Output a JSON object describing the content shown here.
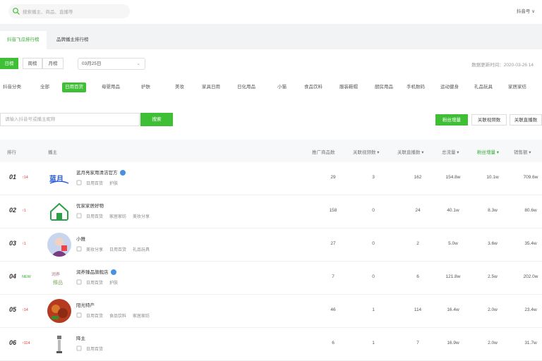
{
  "search": {
    "placeholder": "搜索播主、商品、直播等"
  },
  "user": {
    "label": "抖音号 ∨"
  },
  "tabs": [
    {
      "label": "抖音飞瓜排行榜"
    },
    {
      "label": "品牌播主排行榜"
    }
  ],
  "period": {
    "day": "日榜",
    "week": "周榜",
    "month": "月榜",
    "date": "03月25日"
  },
  "update_text": "数据更新时间：2020-03-26 14",
  "categories": [
    "抖音分类",
    "全部",
    "日用百货",
    "母婴用品",
    "护肤",
    "美妆",
    "家具日用",
    "日化用品",
    "小猫",
    "食品饮料",
    "服装鞋帽",
    "厨房用品",
    "手机数码",
    "运动健身",
    "礼品玩具",
    "家居家纺"
  ],
  "keyword": {
    "placeholder": "请输入抖音号或播主昵称",
    "button": "搜索"
  },
  "sort": [
    "粉丝增量",
    "关联视频数",
    "关联直播数"
  ],
  "columns": [
    "排行",
    "播主",
    "推广商品数",
    "关联视频数",
    "关联直播数",
    "总流量",
    "粉丝增量",
    "销售额"
  ],
  "rows": [
    {
      "rank": "01",
      "change": "↑14",
      "dir": "up",
      "name": "蓝月亮家用清洁官方",
      "verified": true,
      "tags": [
        "日用百货",
        "护肤"
      ],
      "goods": "29",
      "videos": "3",
      "lives": "162",
      "traffic": "154.8w",
      "fans": "10.1w",
      "sales": "709.6w"
    },
    {
      "rank": "02",
      "change": "↑1",
      "dir": "up",
      "name": "优家家居好物",
      "verified": false,
      "tags": [
        "日用百货",
        "家居家纺",
        "美妆分享"
      ],
      "goods": "158",
      "videos": "0",
      "lives": "24",
      "traffic": "40.1w",
      "fans": "8.3w",
      "sales": "80.6w"
    },
    {
      "rank": "03",
      "change": "↑1",
      "dir": "up",
      "name": "小雅",
      "verified": false,
      "tags": [
        "美妆分享",
        "日用百货",
        "礼品玩具"
      ],
      "goods": "27",
      "videos": "0",
      "lives": "2",
      "traffic": "5.0w",
      "fans": "3.6w",
      "sales": "35.4w"
    },
    {
      "rank": "04",
      "change": "NEW",
      "dir": "down",
      "name": "润养臻品旗舰店",
      "verified": true,
      "tags": [
        "日用百货",
        "护肤"
      ],
      "goods": "7",
      "videos": "0",
      "lives": "6",
      "traffic": "121.8w",
      "fans": "2.5w",
      "sales": "202.0w"
    },
    {
      "rank": "05",
      "change": "↑14",
      "dir": "up",
      "name": "阳光特产",
      "verified": false,
      "tags": [
        "日用百货",
        "食品饮料",
        "家居家纺"
      ],
      "goods": "46",
      "videos": "1",
      "lives": "114",
      "traffic": "16.4w",
      "fans": "2.0w",
      "sales": "23.4w"
    },
    {
      "rank": "06",
      "change": "↑114",
      "dir": "up",
      "name": "降主",
      "verified": false,
      "tags": [
        "日用百货"
      ],
      "goods": "6",
      "videos": "1",
      "lives": "7",
      "traffic": "16.9w",
      "fans": "2.0w",
      "sales": "31.7w"
    }
  ],
  "colors": {
    "accent": "#3fbf36",
    "up": "#e33333",
    "new": "#33aa33"
  }
}
